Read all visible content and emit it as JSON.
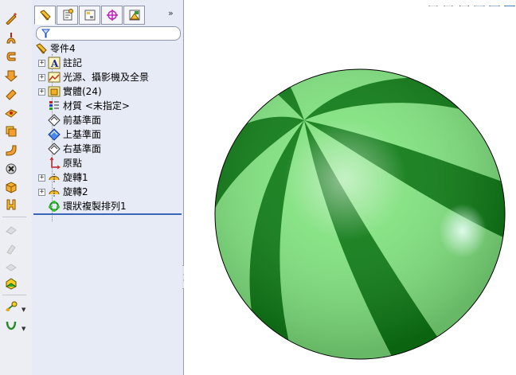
{
  "toolbar": {
    "icons": [
      "sketch-icon",
      "extrude-boss-icon",
      "revolve-boss-icon",
      "loft-icon",
      "sweep-icon",
      "plane-icon",
      "shell-icon",
      "fillet-icon",
      "chamfer-icon",
      "cut-icon",
      "rib-icon",
      "disabled-feature-icon-1",
      "disabled-feature-icon-2",
      "disabled-feature-icon-3",
      "instant3d-icon",
      "reference-geometry-icon",
      "curves-icon"
    ]
  },
  "panel": {
    "tabs": [
      "featuremanager-tab",
      "propertymanager-tab",
      "configurationmanager-tab",
      "dimxpert-tab",
      "display-manager-tab"
    ],
    "more_label": "»"
  },
  "tree": {
    "root": "零件4",
    "items": [
      {
        "label": "註記",
        "icon": "annotations-icon",
        "expandable": true
      },
      {
        "label": "光源、攝影機及全景",
        "icon": "lights-cameras-icon",
        "expandable": true
      },
      {
        "label": "實體(24)",
        "icon": "solid-bodies-icon",
        "expandable": true
      },
      {
        "label": "材質 <未指定>",
        "icon": "material-icon",
        "expandable": false
      },
      {
        "label": "前基準面",
        "icon": "plane-icon",
        "expandable": false
      },
      {
        "label": "上基準面",
        "icon": "plane-selected-icon",
        "expandable": false
      },
      {
        "label": "右基準面",
        "icon": "plane-icon",
        "expandable": false
      },
      {
        "label": "原點",
        "icon": "origin-icon",
        "expandable": false
      },
      {
        "label": "旋轉1",
        "icon": "revolve-icon",
        "expandable": true
      },
      {
        "label": "旋轉2",
        "icon": "revolve-icon",
        "expandable": true
      },
      {
        "label": "環狀複製排列1",
        "icon": "circular-pattern-icon",
        "expandable": false
      }
    ]
  },
  "viewport": {
    "model": "striped-sphere",
    "stripe_colors": [
      "#0d7a14",
      "#7ee07c"
    ]
  }
}
